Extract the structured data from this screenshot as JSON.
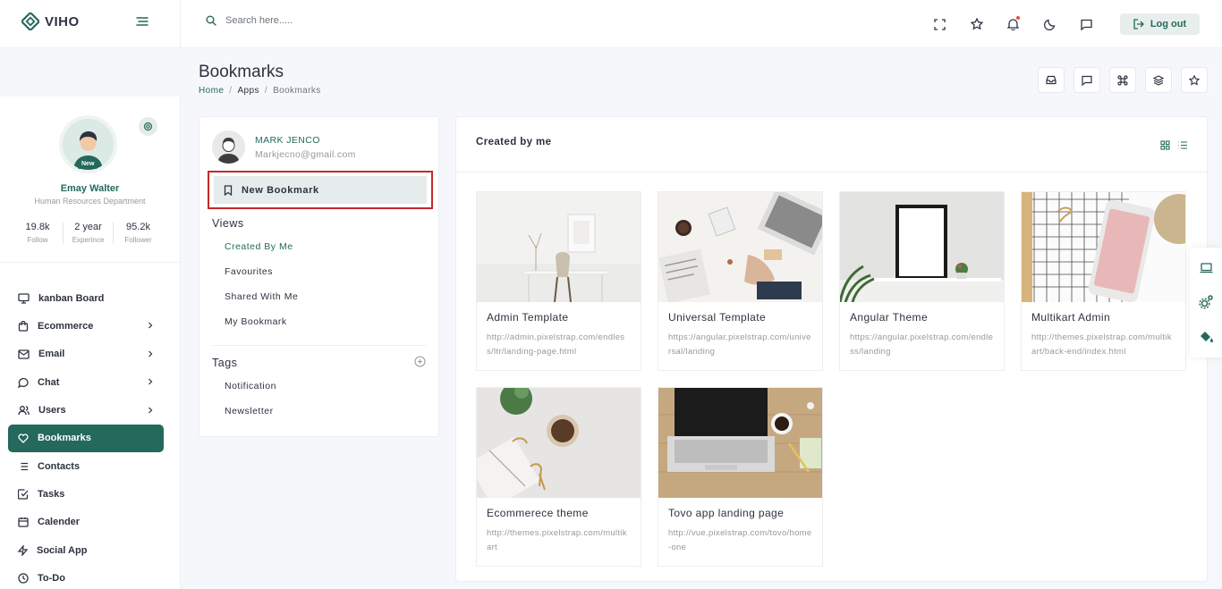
{
  "app": {
    "brand": "VIHO"
  },
  "header": {
    "search_placeholder": "Search here.....",
    "logout_label": "Log out"
  },
  "sidebar": {
    "profile": {
      "badge": "New",
      "name": "Emay Walter",
      "department": "Human Resources Department",
      "stats": [
        {
          "value": "19.8k",
          "label": "Follow"
        },
        {
          "value": "2 year",
          "label": "Experince"
        },
        {
          "value": "95.2k",
          "label": "Follower"
        }
      ]
    },
    "items": [
      {
        "label": "kanban Board",
        "icon": "monitor-icon"
      },
      {
        "label": "Ecommerce",
        "icon": "shopping-bag-icon"
      },
      {
        "label": "Email",
        "icon": "mail-icon"
      },
      {
        "label": "Chat",
        "icon": "chat-icon"
      },
      {
        "label": "Users",
        "icon": "users-icon"
      },
      {
        "label": "Bookmarks",
        "icon": "heart-icon"
      },
      {
        "label": "Contacts",
        "icon": "list-icon"
      },
      {
        "label": "Tasks",
        "icon": "check-square-icon"
      },
      {
        "label": "Calender",
        "icon": "calendar-icon"
      },
      {
        "label": "Social App",
        "icon": "zap-icon"
      },
      {
        "label": "To-Do",
        "icon": "clock-icon"
      }
    ]
  },
  "page": {
    "title": "Bookmarks",
    "breadcrumb": [
      "Home",
      "Apps",
      "Bookmarks"
    ]
  },
  "left_panel": {
    "user_name": "MARK JENCO",
    "user_email": "Markjecno@gmail.com",
    "new_bookmark_label": "New Bookmark",
    "views_title": "Views",
    "views": [
      "Created By Me",
      "Favourites",
      "Shared With Me",
      "My Bookmark"
    ],
    "tags_title": "Tags",
    "tags": [
      "Notification",
      "Newsletter"
    ]
  },
  "content": {
    "title": "Created by me",
    "bookmarks": [
      {
        "title": "Admin Template",
        "url": "http://admin.pixelstrap.com/endless/ltr/landing-page.html"
      },
      {
        "title": "Universal Template",
        "url": "https://angular.pixelstrap.com/universal/landing"
      },
      {
        "title": "Angular Theme",
        "url": "https://angular.pixelstrap.com/endless/landing"
      },
      {
        "title": "Multikart Admin",
        "url": "http://themes.pixelstrap.com/multikart/back-end/index.html"
      },
      {
        "title": "Ecommerece theme",
        "url": "http://themes.pixelstrap.com/multikart"
      },
      {
        "title": "Tovo app landing page",
        "url": "http://vue.pixelstrap.com/tovo/home-one"
      }
    ]
  },
  "colors": {
    "primary": "#24695c",
    "highlight_border": "#c62828",
    "notification_dot": "#e74c3c"
  }
}
